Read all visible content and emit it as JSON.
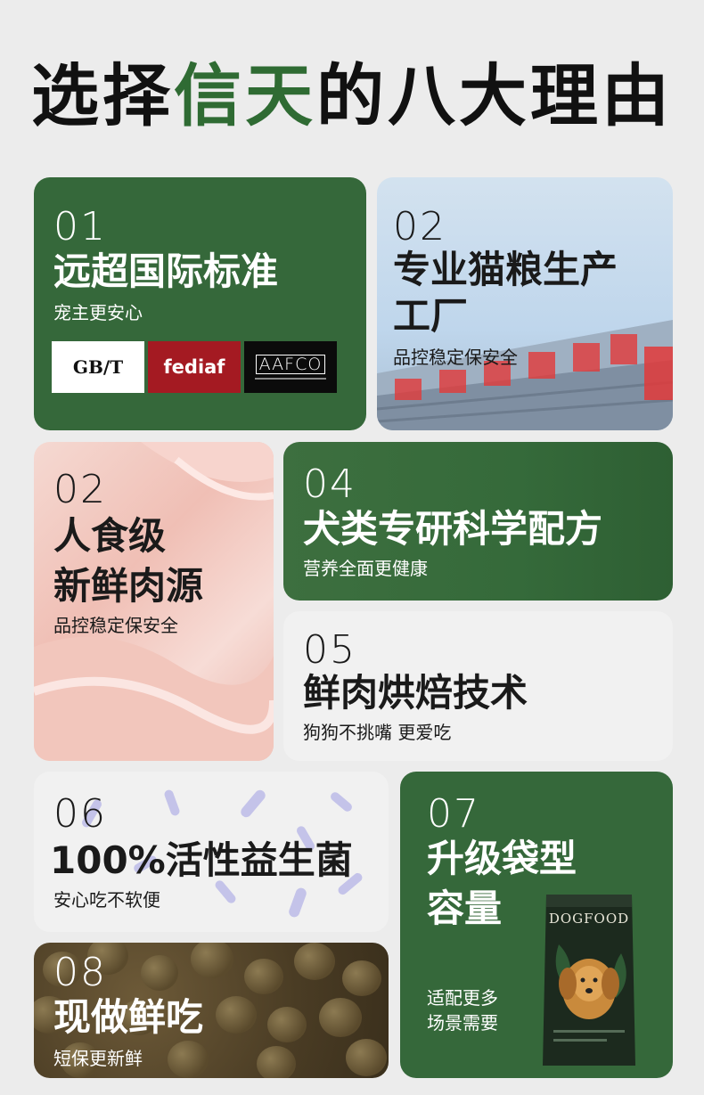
{
  "title": {
    "part1": "选择",
    "highlight": "信天",
    "part2": "的八大理由"
  },
  "colors": {
    "brand_green": "#35683a",
    "card_light": "#f1f1f1",
    "fediaf_red": "#a41a22"
  },
  "cards": [
    {
      "num": "01",
      "heading": "远超国际标准",
      "sub": "宠主更安心",
      "logos": {
        "gbt": "GB/T",
        "fediaf": "fediaf",
        "aafco": "AAFCO"
      }
    },
    {
      "num": "02",
      "heading_line1": "专业猫粮生产",
      "heading_line2": "工厂",
      "sub": "品控稳定保安全"
    },
    {
      "num": "02",
      "heading_line1": "人食级",
      "heading_line2": "新鲜肉源",
      "sub": "品控稳定保安全"
    },
    {
      "num": "04",
      "heading": "犬类专研科学配方",
      "sub": "营养全面更健康"
    },
    {
      "num": "05",
      "heading": "鲜肉烘焙技术",
      "sub": "狗狗不挑嘴 更爱吃"
    },
    {
      "num": "06",
      "heading": "100%活性益生菌",
      "sub": "安心吃不软便"
    },
    {
      "num": "07",
      "heading_line1": "升级袋型",
      "heading_line2": "容量",
      "sub_line1": "适配更多",
      "sub_line2": "场景需要",
      "bag_label": "DOGFOOD"
    },
    {
      "num": "08",
      "heading": "现做鲜吃",
      "sub": "短保更新鲜"
    }
  ]
}
